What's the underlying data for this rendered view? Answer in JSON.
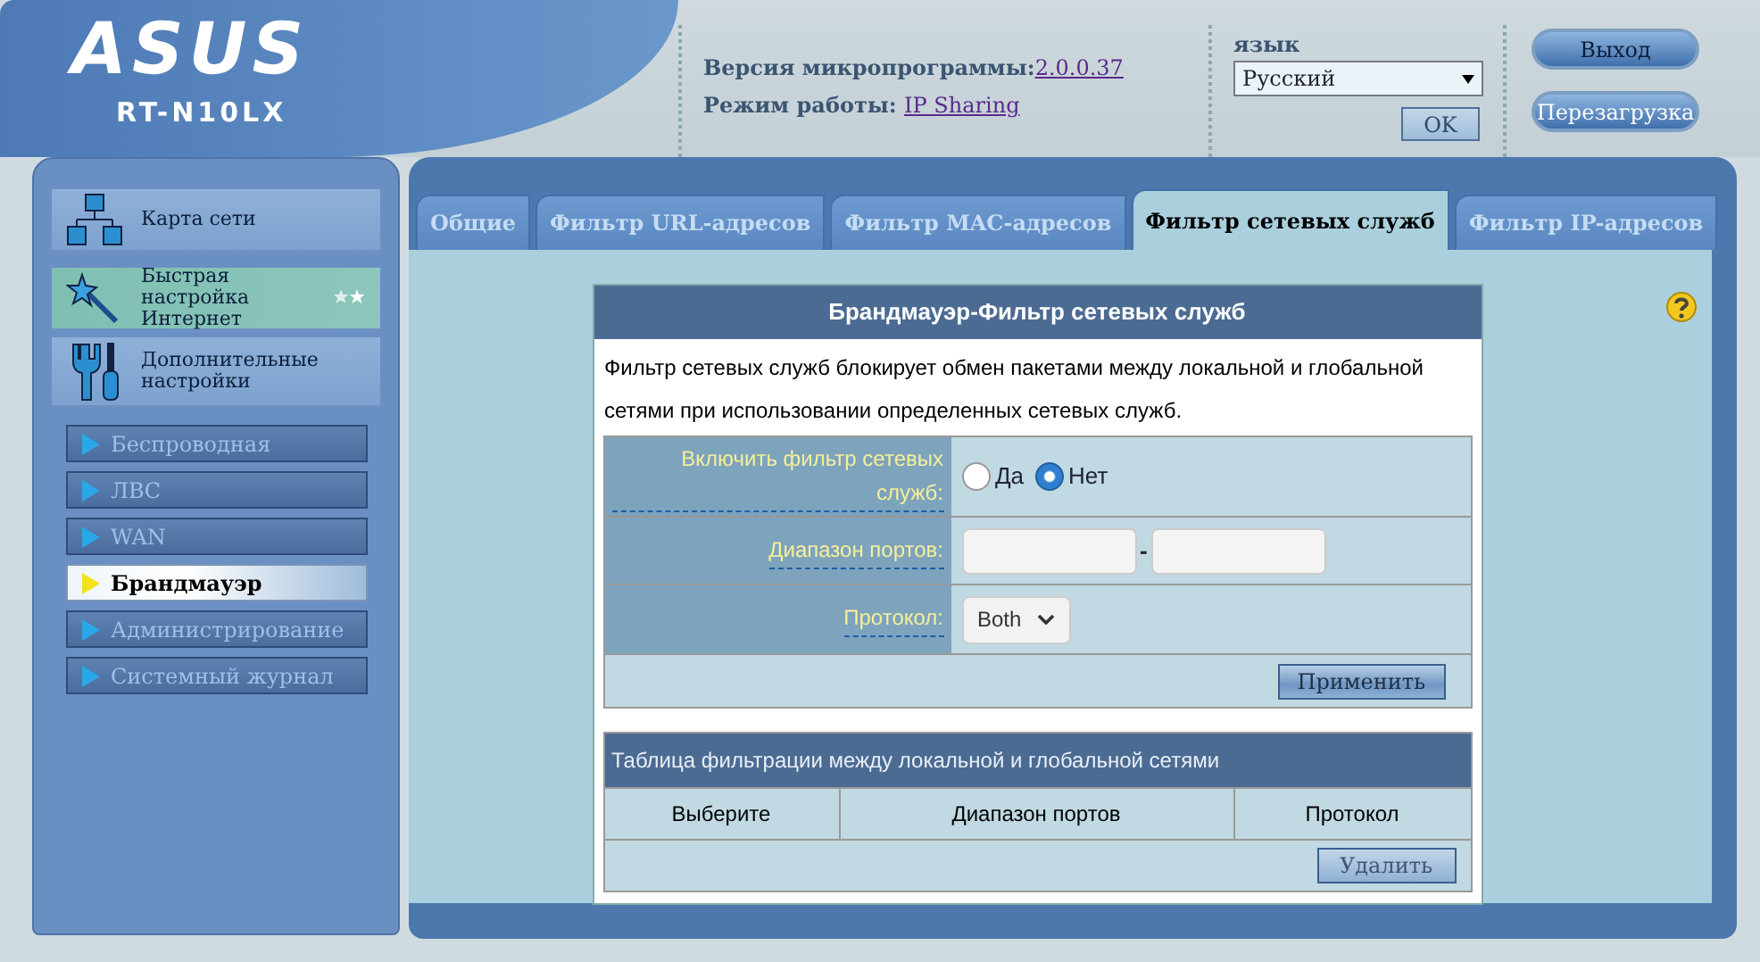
{
  "header": {
    "logo": "ASUS",
    "model": "RT-N10LX",
    "firmware_label": "Версия микропрограммы:",
    "firmware_version": "2.0.0.37",
    "mode_label": "Режим работы:",
    "mode_value": "IP Sharing",
    "language_label": "язык",
    "language_value": "Русский",
    "ok_button": {
      "label": "OK",
      "disabled": true
    },
    "buttons": [
      "Выход",
      "Перезагрузка"
    ]
  },
  "sidebar": {
    "main_items": [
      {
        "label": "Карта сети",
        "kind": "network"
      },
      {
        "label": "Быстрая настройка Интернет",
        "kind": "wizard"
      },
      {
        "label": "Дополнительные настройки",
        "kind": "tools"
      }
    ],
    "sub_items": [
      {
        "label": "Беспроводная",
        "selected": false
      },
      {
        "label": "ЛВС",
        "selected": false
      },
      {
        "label": "WAN",
        "selected": false
      },
      {
        "label": "Брандмауэр",
        "selected": true
      },
      {
        "label": "Администрирование",
        "selected": false
      },
      {
        "label": "Системный журнал",
        "selected": false
      }
    ]
  },
  "tabs": [
    {
      "label": "Общие",
      "selected": false
    },
    {
      "label": "Фильтр URL-адресов",
      "selected": false
    },
    {
      "label": "Фильтр MAC-адресов",
      "selected": false
    },
    {
      "label": "Фильтр сетевых служб",
      "selected": true
    },
    {
      "label": "Фильтр IP-адресов",
      "selected": false
    }
  ],
  "form": {
    "title": "Брандмауэр-Фильтр сетевых служб",
    "description": "Фильтр сетевых служб блокирует обмен пакетами между локальной и глобальной сетями при использовании определенных сетевых служб.",
    "enable_label": "Включить фильтр сетевых служб:",
    "enable_options": [
      {
        "label": "Да",
        "checked": false
      },
      {
        "label": "Нет",
        "checked": true
      }
    ],
    "port_range_label": "Диапазон портов:",
    "port_separator": "-",
    "protocol_label": "Протокол:",
    "protocol_value": "Both",
    "apply_button": {
      "label": "Применить",
      "disabled": false
    }
  },
  "table": {
    "title": "Таблица фильтрации между локальной и глобальной сетями",
    "columns": [
      "Выберите",
      "Диапазон портов",
      "Протокол"
    ],
    "delete_button": {
      "label": "Удалить",
      "disabled": true
    }
  }
}
